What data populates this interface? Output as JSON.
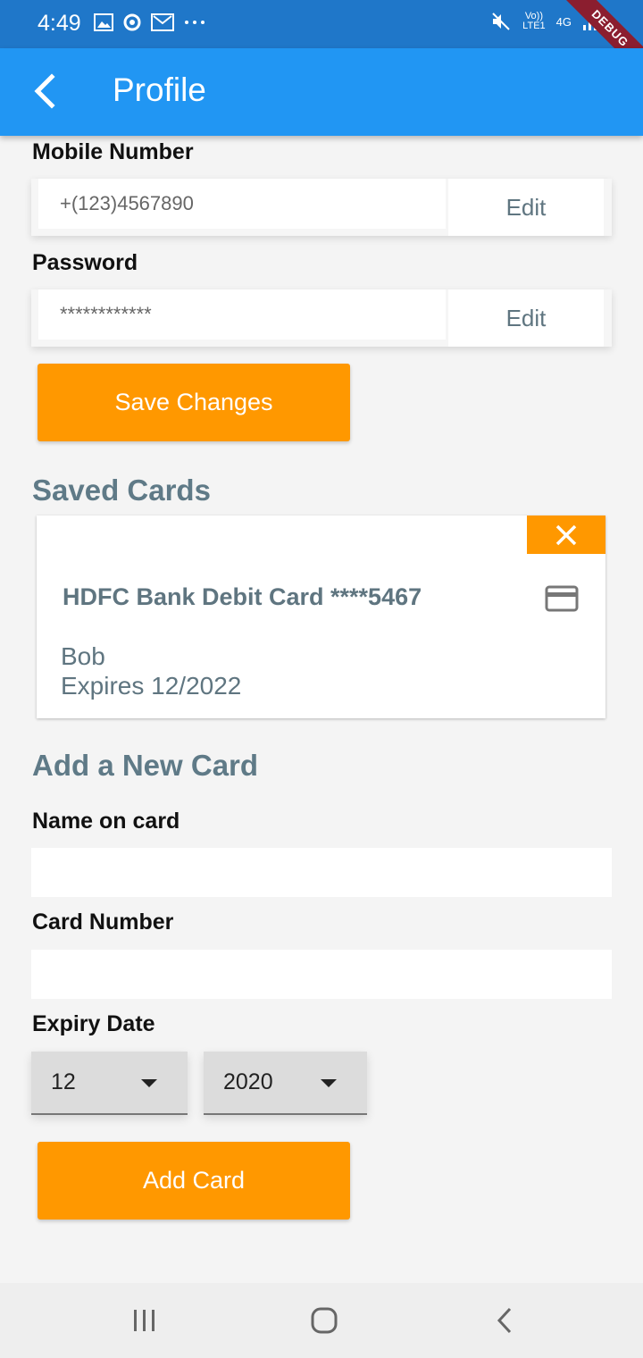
{
  "status_bar": {
    "time": "4:49",
    "net_top": "Vo))",
    "net_bottom": "LTE1",
    "net_type": "4G",
    "debug_label": "DEBUG"
  },
  "app_bar": {
    "title": "Profile"
  },
  "mobile": {
    "label": "Mobile Number",
    "value": "+(123)4567890",
    "edit_label": "Edit"
  },
  "password": {
    "label": "Password",
    "value": "************",
    "edit_label": "Edit"
  },
  "save_button": {
    "label": "Save Changes"
  },
  "saved_cards": {
    "title": "Saved Cards",
    "card": {
      "name": "HDFC Bank Debit Card ****5467",
      "holder": "Bob",
      "expiry": "Expires 12/2022"
    }
  },
  "new_card": {
    "title": "Add a New Card",
    "name_label": "Name on card",
    "number_label": "Card Number",
    "expiry_label": "Expiry Date",
    "month": "12",
    "year": "2020",
    "button_label": "Add Card"
  },
  "colors": {
    "app_bar": "#2196f3",
    "status_bar": "#1f77c9",
    "accent": "#ff9800",
    "section_text": "#5f7a87"
  }
}
